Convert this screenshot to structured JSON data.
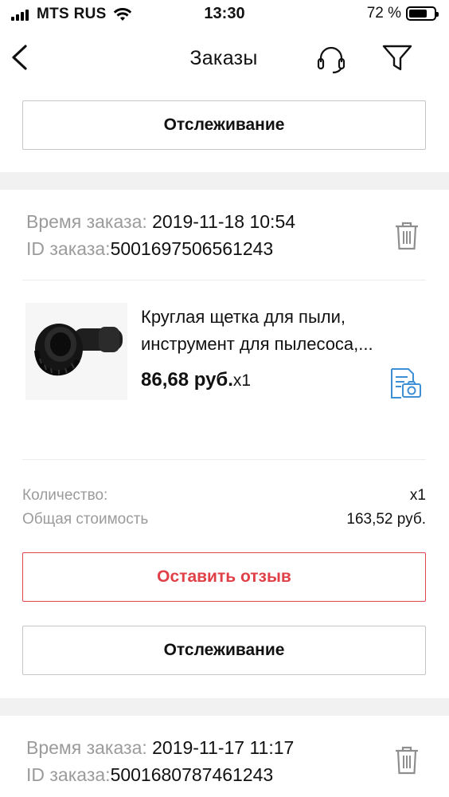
{
  "status_bar": {
    "carrier": "MTS RUS",
    "time": "13:30",
    "battery": "72 %",
    "battery_level": 0.72
  },
  "nav": {
    "title": "Заказы",
    "icons": [
      "back-arrow-icon",
      "headset-icon",
      "filter-icon"
    ]
  },
  "top_tracking_button": "Отслеживание",
  "orders": [
    {
      "time_label": "Время заказа: ",
      "time_value": "2019-11-18 10:54",
      "id_label": "ID заказа:",
      "id_value": "5001697506561243",
      "product_name": "Круглая щетка для пыли, инструмент для пылесоса,...",
      "product_price": "86,68 руб.",
      "product_qty": "x1",
      "quantity_label": "Количество:",
      "quantity_value": "x1",
      "total_label": "Общая стоимость",
      "total_value": "163,52 руб.",
      "review_button": "Оставить отзыв",
      "tracking_button": "Отслеживание"
    },
    {
      "time_label": "Время заказа: ",
      "time_value": "2019-11-17 11:17",
      "id_label": "ID заказа:",
      "id_value": "5001680787461243"
    }
  ],
  "colors": {
    "accent_red": "#e04048",
    "doc_icon_blue": "#3d8fd6",
    "separator": "#f1f1f1",
    "muted_text": "#9b9b9b"
  }
}
